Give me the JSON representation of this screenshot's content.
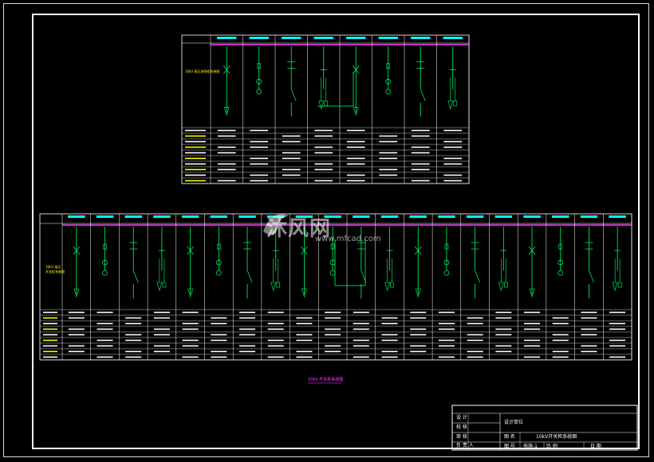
{
  "drawing": {
    "caption": "10kV 开关柜系统图",
    "panel1_side_label": "10kV 高压进线柜系统图",
    "panel2_side_label_line1": "10kV 高压",
    "panel2_side_label_line2": "开关柜系统图"
  },
  "watermark": {
    "brand": "沐风网",
    "url": "www.mfcad.com"
  },
  "title_block": {
    "design_unit_label": "设计单位",
    "drawing_name": "10kV开关柜系统图",
    "rows": [
      "设 计",
      "校 核",
      "审 核",
      "负 责 人"
    ],
    "footer_cells": [
      "图 号",
      "电施-1",
      "比 例",
      "日 期"
    ],
    "name_label": "图 名"
  },
  "colors": {
    "background": "#000000",
    "frame": "#ffffff",
    "schematic": "#00ff66",
    "busbar": "#ff40ff",
    "header_text": "#00ffff",
    "table_text": "#ffffff",
    "accent_text": "#ffff00"
  }
}
